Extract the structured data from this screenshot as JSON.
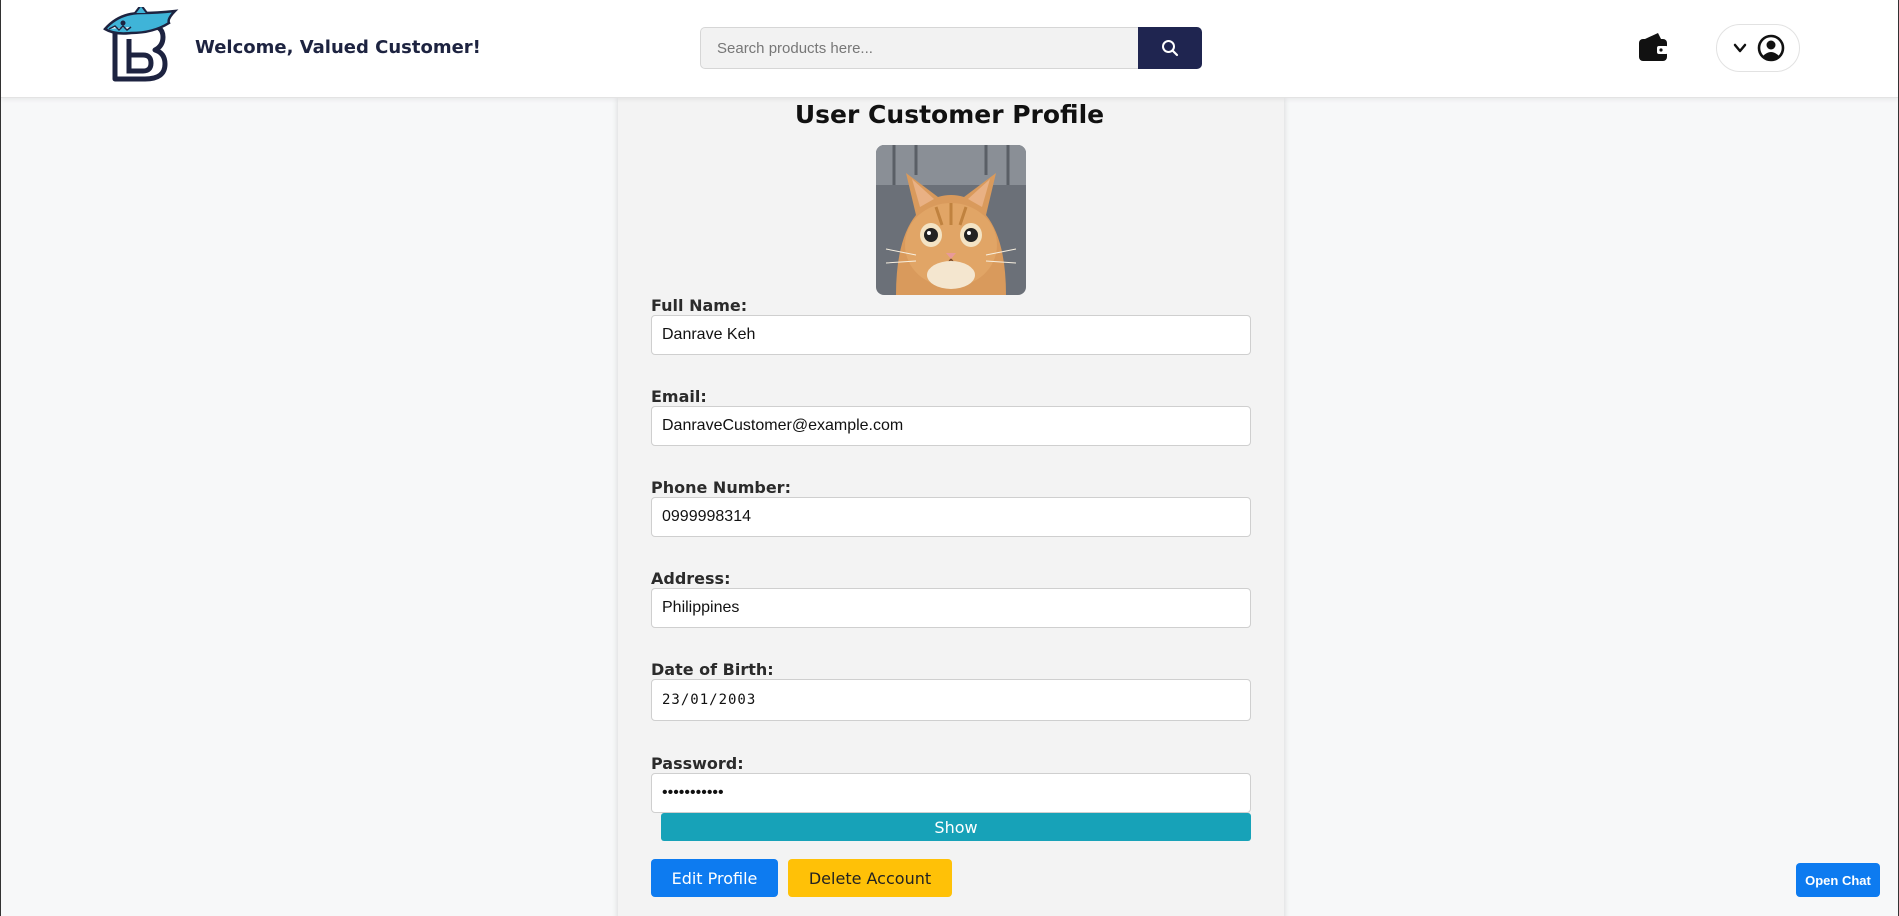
{
  "header": {
    "welcome_text": "Welcome, Valued Customer!",
    "search_placeholder": "Search products here...",
    "search_value": ""
  },
  "icons": {
    "logo": "shark-b-logo",
    "search": "search-icon",
    "wallet": "wallet-icon",
    "dropdown": "chevron-down-icon",
    "account": "user-circle-icon"
  },
  "profile": {
    "title": "User Customer Profile",
    "avatar": "cat-photo",
    "fields": {
      "full_name": {
        "label": "Full Name:",
        "value": "Danrave Keh"
      },
      "email": {
        "label": "Email:",
        "value": "DanraveCustomer@example.com"
      },
      "phone": {
        "label": "Phone Number:",
        "value": "0999998314"
      },
      "address": {
        "label": "Address:",
        "value": "Philippines"
      },
      "dob": {
        "label": "Date of Birth:",
        "value": "23/01/2003"
      },
      "password": {
        "label": "Password:",
        "value": "•••••••••••"
      }
    },
    "show_label": "Show",
    "edit_label": "Edit Profile",
    "delete_label": "Delete Account"
  },
  "chat": {
    "open_label": "Open Chat"
  },
  "colors": {
    "navy": "#1f2550",
    "teal": "#17a2b8",
    "primary": "#0d7bf0",
    "warning": "#ffc107"
  }
}
